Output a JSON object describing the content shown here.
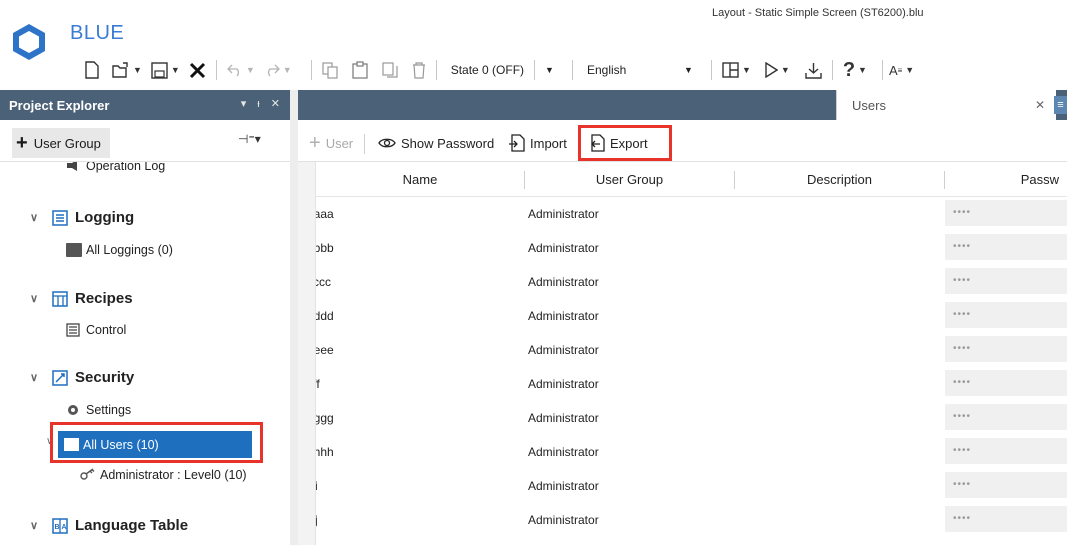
{
  "app": {
    "name": "BLUE",
    "window_title": "Layout - Static Simple Screen (ST6200).blu",
    "logo": "hexagon-logo"
  },
  "toolbar": {
    "state_label": "State 0 (OFF)",
    "language_label": "English"
  },
  "left_pane": {
    "title": "Project Explorer",
    "header_controls": "▾ ᵻ ✕",
    "add_group_label": "User Group",
    "pin_label": "⊣⁼▾",
    "tree": {
      "operation_log": "Operation Log",
      "logging": "Logging",
      "all_loggings": "All Loggings (0)",
      "recipes": "Recipes",
      "control": "Control",
      "security": "Security",
      "settings": "Settings",
      "all_users": "All Users (10)",
      "administrator": "Administrator : Level0 (10)",
      "language_table": "Language Table"
    }
  },
  "right_pane": {
    "tab_label": "Users",
    "toolbar": {
      "add_user": "User",
      "show_password": "Show Password",
      "import": "Import",
      "export": "Export"
    },
    "columns": [
      "Name",
      "User Group",
      "Description",
      "Passw"
    ],
    "rows": [
      {
        "name": "aaaa",
        "group": "Administrator",
        "description": "",
        "password": "••••"
      },
      {
        "name": "bbbb",
        "group": "Administrator",
        "description": "",
        "password": "••••"
      },
      {
        "name": "cccc",
        "group": "Administrator",
        "description": "",
        "password": "••••"
      },
      {
        "name": "dddd",
        "group": "Administrator",
        "description": "",
        "password": "••••"
      },
      {
        "name": "eeee",
        "group": "Administrator",
        "description": "",
        "password": "••••"
      },
      {
        "name": "ffff",
        "group": "Administrator",
        "description": "",
        "password": "••••"
      },
      {
        "name": "gggg",
        "group": "Administrator",
        "description": "",
        "password": "••••"
      },
      {
        "name": "hhhh",
        "group": "Administrator",
        "description": "",
        "password": "••••"
      },
      {
        "name": "iiii",
        "group": "Administrator",
        "description": "",
        "password": "••••"
      },
      {
        "name": "jjjj",
        "group": "Administrator",
        "description": "",
        "password": "••••"
      }
    ]
  },
  "colors": {
    "pane_header": "#4a6178",
    "selection": "#1f6fbf",
    "highlight_box": "#e8332a",
    "brand": "#3a7bd5"
  }
}
